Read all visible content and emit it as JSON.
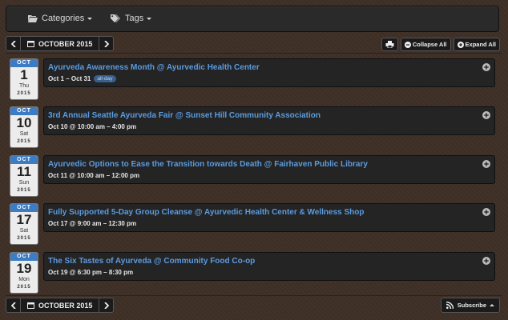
{
  "filters": {
    "categories_label": "Categories",
    "tags_label": "Tags"
  },
  "navigation": {
    "month_label": "OCTOBER 2015"
  },
  "toolbar": {
    "collapse_label": "Collapse All",
    "expand_label": "Expand All"
  },
  "events": [
    {
      "month": "OCT",
      "day": "1",
      "weekday": "Thu",
      "year": "2015",
      "title": "Ayurveda Awareness Month @ Ayurvedic Health Center",
      "time": "Oct 1 – Oct 31",
      "badge": "all-day"
    },
    {
      "month": "OCT",
      "day": "10",
      "weekday": "Sat",
      "year": "2015",
      "title": "3rd Annual Seattle Ayurveda Fair @ Sunset Hill Community Association",
      "time": "Oct 10 @ 10:00 am – 4:00 pm"
    },
    {
      "month": "OCT",
      "day": "11",
      "weekday": "Sun",
      "year": "2015",
      "title": "Ayurvedic Options to Ease the Transition towards Death @ Fairhaven Public Library",
      "time": "Oct 11 @ 10:00 am – 12:00 pm"
    },
    {
      "month": "OCT",
      "day": "17",
      "weekday": "Sat",
      "year": "2015",
      "title": "Fully Supported 5-Day Group Cleanse @ Ayurvedic Health Center & Wellness Shop",
      "time": "Oct 17 @ 9:00 am – 12:30 pm"
    },
    {
      "month": "OCT",
      "day": "19",
      "weekday": "Mon",
      "year": "2015",
      "title": "The Six Tastes of Ayurveda @ Community Food Co-op",
      "time": "Oct 19 @ 6:30 pm – 8:30 pm"
    }
  ],
  "footer": {
    "subscribe_label": "Subscribe"
  },
  "colors": {
    "accent": "#3d7bc2",
    "link": "#5b9be0",
    "background": "#3e3026"
  }
}
